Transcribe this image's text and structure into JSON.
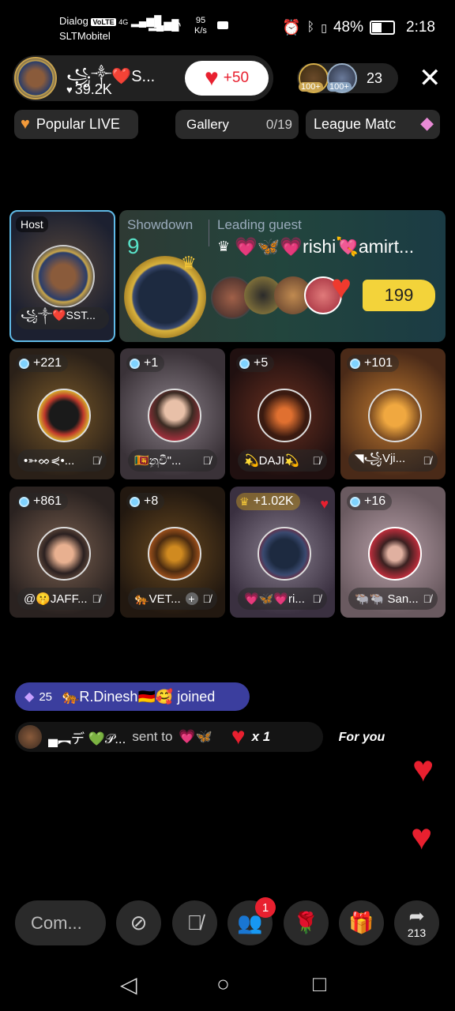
{
  "status_bar": {
    "carrier1": "Dialog",
    "carrier2": "SLTMobitel",
    "volte": "VoLTE",
    "net_type": "4G",
    "speed_value": "95",
    "speed_unit": "K/s",
    "battery": "48%",
    "time": "2:18"
  },
  "host": {
    "name": "꧁༒❤️S...",
    "likes": "39.2K",
    "like_boost": "+50",
    "viewer_count": "23",
    "viewer_badge_1": "100+",
    "viewer_badge_2": "100+"
  },
  "chips": {
    "popular": "Popular LIVE",
    "gallery_label": "Gallery",
    "gallery_count": "0/19",
    "league": "League Matc"
  },
  "showdown": {
    "host_tag": "Host",
    "host_name": "꧁༒❤️SST...",
    "label": "Showdown",
    "count": "9",
    "leading_label": "Leading guest",
    "leading_name": "💗🦋💗rishi💘amirt...",
    "score": "199"
  },
  "guests": [
    {
      "points": "+221",
      "name": "•➳ᨖ⋞•..."
    },
    {
      "points": "+1",
      "name": "🇱🇰නුවී\"..."
    },
    {
      "points": "+5",
      "name": "💫DAJI💫"
    },
    {
      "points": "+101",
      "name": "◥꧁Vji..."
    },
    {
      "points": "+861",
      "name": "@🤫JAFF..."
    },
    {
      "points": "+8",
      "name": "🐅VET..."
    },
    {
      "points": "+1.02K",
      "name": "💗🦋💗ri..."
    },
    {
      "points": "+16",
      "name": "🐃🐃 San..."
    }
  ],
  "feed": {
    "join_level": "25",
    "join_text": "🐅R.Dinesh🇩🇪🥰 joined",
    "gift_sender": "▄︻デ 💚𝒫...",
    "gift_sent_to": "sent to",
    "gift_mult": "x 1",
    "for_you": "For you"
  },
  "bottom": {
    "comment_placeholder": "Com...",
    "request_badge": "1",
    "share_count": "213"
  },
  "colors": {
    "accent_red": "#e8202f",
    "score_yellow": "#f3d33a",
    "join_bg": "#3b3e9e",
    "gold": "#d7b04a"
  }
}
